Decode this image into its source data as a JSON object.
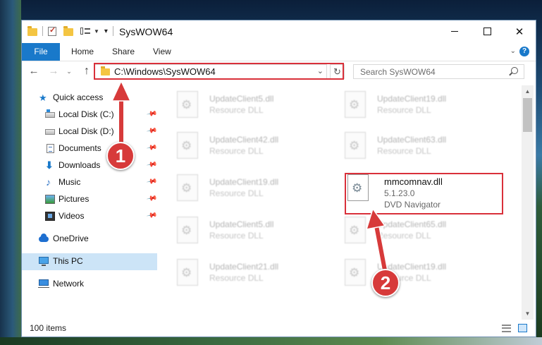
{
  "window": {
    "title": "SysWOW64",
    "minimize_icon": "minimize-icon",
    "maximize_icon": "maximize-icon",
    "close_glyph": "✕"
  },
  "ribbon": {
    "tabs": [
      "File",
      "Home",
      "Share",
      "View"
    ],
    "expand_glyph": "⌄",
    "help_glyph": "?"
  },
  "navigation": {
    "back_glyph": "←",
    "forward_glyph": "→",
    "recent_glyph": "⌄",
    "up_glyph": "↑",
    "address": "C:\\Windows\\SysWOW64",
    "address_dropdown_glyph": "⌄",
    "refresh_glyph": "↻",
    "search_placeholder": "Search SysWOW64"
  },
  "sidebar": {
    "items": [
      {
        "label": "Quick access",
        "icon": "star-icon",
        "pinned": false
      },
      {
        "label": "Local Disk (C:)",
        "icon": "drive-c-icon",
        "pinned": true
      },
      {
        "label": "Local Disk (D:)",
        "icon": "drive-d-icon",
        "pinned": true
      },
      {
        "label": "Documents",
        "icon": "documents-icon",
        "pinned": true
      },
      {
        "label": "Downloads",
        "icon": "downloads-icon",
        "pinned": true
      },
      {
        "label": "Music",
        "icon": "music-icon",
        "pinned": true
      },
      {
        "label": "Pictures",
        "icon": "pictures-icon",
        "pinned": true
      },
      {
        "label": "Videos",
        "icon": "videos-icon",
        "pinned": true
      },
      {
        "label": "OneDrive",
        "icon": "onedrive-icon",
        "pinned": false
      },
      {
        "label": "This PC",
        "icon": "this-pc-icon",
        "pinned": false,
        "selected": true
      },
      {
        "label": "Network",
        "icon": "network-icon",
        "pinned": false
      }
    ],
    "pin_glyph": "📌"
  },
  "files": {
    "left_column": [
      {
        "name": "UpdateClient5.dll",
        "type": "Resource DLL"
      },
      {
        "name": "UpdateClient42.dll",
        "type": "Resource DLL"
      },
      {
        "name": "UpdateClient19.dll",
        "type": "Resource DLL"
      },
      {
        "name": "UpdateClient5.dll",
        "type": "Resource DLL"
      },
      {
        "name": "UpdateClient21.dll",
        "type": "Resource DLL"
      }
    ],
    "right_column": [
      {
        "name": "UpdateClient19.dll",
        "type": "Resource DLL"
      },
      {
        "name": "UpdateClient63.dll",
        "type": "Resource DLL"
      },
      null,
      {
        "name": "UpdateClient65.dll",
        "type": "Resource DLL"
      },
      {
        "name": "UpdateClient19.dll",
        "type": "Resource DLL"
      }
    ],
    "target": {
      "name": "mmcomnav.dll",
      "version": "5.1.23.0",
      "description": "DVD Navigator"
    }
  },
  "scrollbar": {
    "up_glyph": "▲",
    "down_glyph": "▼"
  },
  "status": {
    "item_count": "100 items"
  },
  "annotations": {
    "step1": "1",
    "step2": "2",
    "highlight_color": "#d9303a",
    "badge_color": "#d73a3a"
  },
  "colors": {
    "accent": "#1979ca",
    "selection": "#cce4f7"
  }
}
